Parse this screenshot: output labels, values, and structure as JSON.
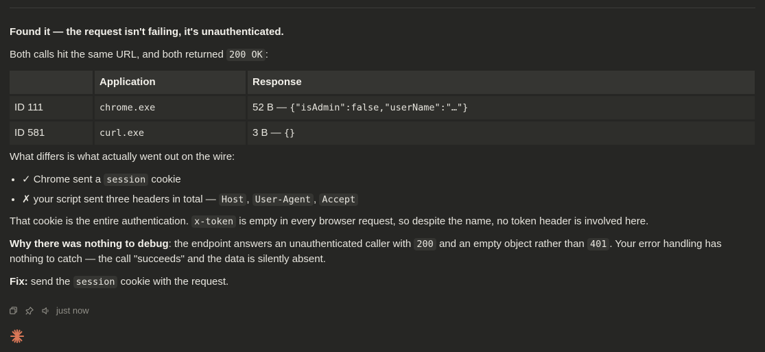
{
  "message": {
    "heading": "Found it — the request isn't failing, it's unauthenticated.",
    "intro": {
      "before": "Both calls hit the same URL, and both returned ",
      "code": "200 OK",
      "after": ":"
    },
    "table": {
      "headers": [
        "",
        "Application",
        "Response"
      ],
      "rows": [
        {
          "id": "ID 111",
          "app": "chrome.exe",
          "size": "52 B — ",
          "body": "{\"isAdmin\":false,\"userName\":\"…\"}"
        },
        {
          "id": "ID 581",
          "app": "curl.exe",
          "size": "3 B — ",
          "body": "{}"
        }
      ]
    },
    "differs": "What differs is what actually went out on the wire:",
    "bullets": {
      "chrome": {
        "before": "✓ Chrome sent a ",
        "code": "session",
        "after": " cookie"
      },
      "script": {
        "before": "✗ your script sent three headers in total — ",
        "codes": [
          "Host",
          "User-Agent",
          "Accept"
        ],
        "sep": ", "
      }
    },
    "cookie_para": {
      "before": "That cookie is the entire authentication. ",
      "code": "x-token",
      "after": " is empty in every browser request, so despite the name, no token header is involved here."
    },
    "debug_para": {
      "lead": "Why there was nothing to debug",
      "text1": ": the endpoint answers an unauthenticated caller with ",
      "code1": "200",
      "text2": " and an empty object rather than ",
      "code2": "401",
      "text3": ". Your error handling has nothing to catch — the call \"succeeds\" and the data is silently absent."
    },
    "fix_para": {
      "lead": "Fix:",
      "before": " send the ",
      "code": "session",
      "after": " cookie with the request."
    }
  },
  "actions": {
    "timestamp": "just now",
    "icons": [
      "copy-icon",
      "pin-icon",
      "speaker-icon"
    ]
  },
  "colors": {
    "background": "#262624",
    "text": "#e6e4dd",
    "code_bg": "#353532",
    "accent": "#d97757"
  }
}
